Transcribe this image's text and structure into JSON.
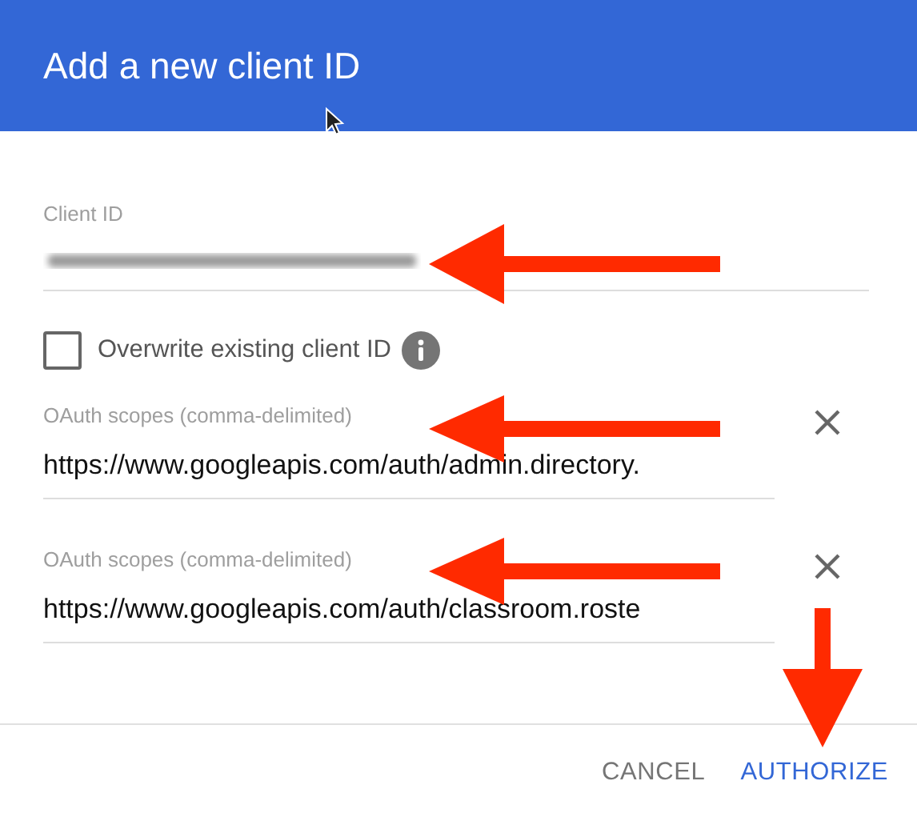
{
  "dialog": {
    "title": "Add a new client ID"
  },
  "client_id": {
    "label": "Client ID",
    "blurred": true
  },
  "overwrite": {
    "label": "Overwrite existing client ID",
    "checked": false
  },
  "scopes": [
    {
      "label": "OAuth scopes (comma-delimited)",
      "value": "https://www.googleapis.com/auth/admin.directory."
    },
    {
      "label": "OAuth scopes (comma-delimited)",
      "value": "https://www.googleapis.com/auth/classroom.roste"
    }
  ],
  "buttons": [
    {
      "label": "CANCEL",
      "kind": "secondary"
    },
    {
      "label": "AUTHORIZE",
      "kind": "primary"
    }
  ]
}
